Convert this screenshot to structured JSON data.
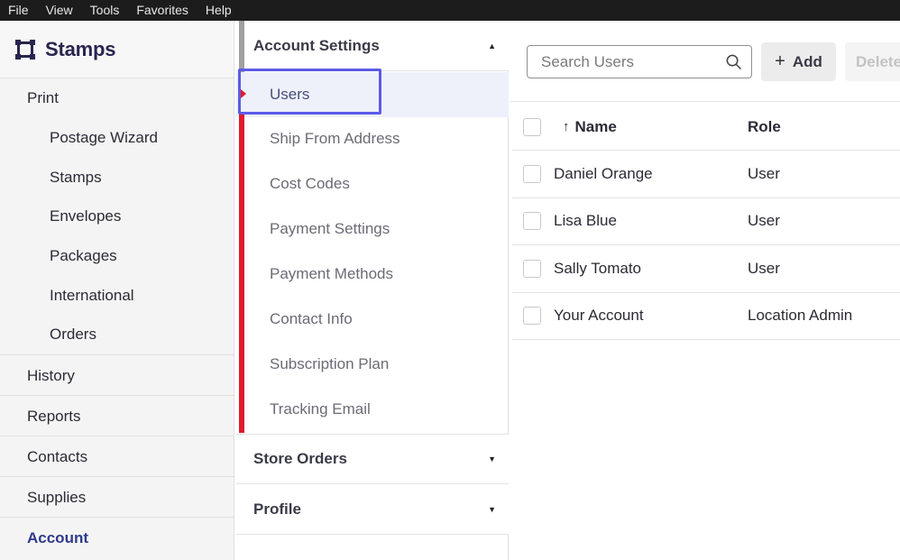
{
  "menubar": {
    "items": [
      "File",
      "View",
      "Tools",
      "Favorites",
      "Help"
    ]
  },
  "sidebar": {
    "brand": "Stamps",
    "print_label": "Print",
    "print_items": [
      "Postage Wizard",
      "Stamps",
      "Envelopes",
      "Packages",
      "International",
      "Orders"
    ],
    "main_items": [
      "History",
      "Reports",
      "Contacts",
      "Supplies",
      "Account"
    ],
    "active": "Account"
  },
  "settings": {
    "account_settings": {
      "title": "Account Settings",
      "expanded": true,
      "items": [
        "Users",
        "Ship From Address",
        "Cost Codes",
        "Payment Settings",
        "Payment Methods",
        "Contact Info",
        "Subscription Plan",
        "Tracking Email"
      ],
      "active": "Users"
    },
    "store_orders": {
      "title": "Store Orders",
      "expanded": false
    },
    "profile": {
      "title": "Profile",
      "expanded": false
    }
  },
  "toolbar": {
    "search_placeholder": "Search Users",
    "add_label": "Add",
    "delete_label": "Delete"
  },
  "users_table": {
    "headers": {
      "name": "Name",
      "role": "Role",
      "sort_indicator": "↑"
    },
    "rows": [
      {
        "name": "Daniel Orange",
        "role": "User"
      },
      {
        "name": "Lisa Blue",
        "role": "User"
      },
      {
        "name": "Sally Tomato",
        "role": "User"
      },
      {
        "name": "Your Account",
        "role": "Location Admin"
      }
    ]
  },
  "colors": {
    "brand": "#29254f",
    "active_nav": "#2e3a8c",
    "accent_red": "#e01b2d",
    "focus_ring": "#5b5be8"
  }
}
